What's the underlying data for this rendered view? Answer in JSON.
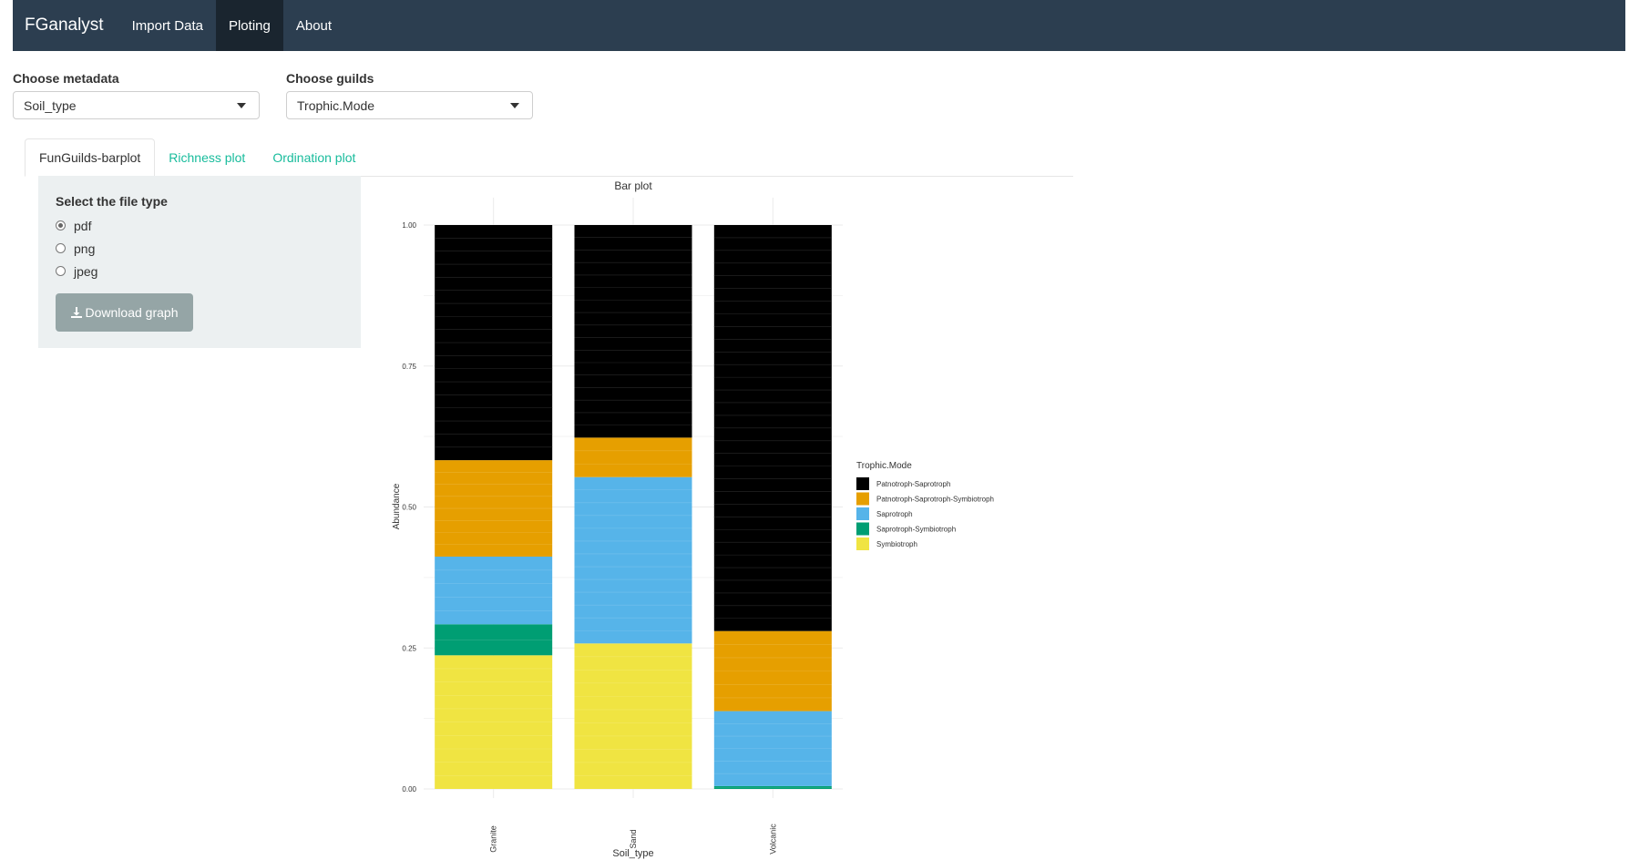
{
  "navbar": {
    "brand": "FGanalyst",
    "items": [
      "Import Data",
      "Ploting",
      "About"
    ],
    "active": "Ploting"
  },
  "controls": {
    "metadata": {
      "label": "Choose metadata",
      "value": "Soil_type"
    },
    "guilds": {
      "label": "Choose guilds",
      "value": "Trophic.Mode"
    }
  },
  "tabs": [
    "FunGuilds-barplot",
    "Richness plot",
    "Ordination plot"
  ],
  "panel": {
    "title": "Select the file type",
    "options": [
      "pdf",
      "png",
      "jpeg"
    ],
    "selected": "pdf",
    "download_label": "Download graph"
  },
  "colors": {
    "navbar_bg": "#2c3e50",
    "navbar_active": "#1a252f",
    "tab_link": "#18bc9c",
    "panel_bg": "#ecf0f1",
    "button_bg": "#95a5a6"
  },
  "chart_data": {
    "type": "bar",
    "stacked": true,
    "title": "Bar plot",
    "xlabel": "Soil_type",
    "ylabel": "Abundance",
    "ylim": [
      0,
      1
    ],
    "yticks": [
      "0.00",
      "0.25",
      "0.50",
      "0.75",
      "1.00"
    ],
    "categories": [
      "Granite",
      "Sand",
      "Volcanic"
    ],
    "legend_title": "Trophic.Mode",
    "legend_position": "right",
    "series": [
      {
        "name": "Symbiotroph",
        "color": "#f0e442",
        "values": [
          0.237,
          0.258,
          0.0
        ]
      },
      {
        "name": "Saprotroph-Symbiotroph",
        "color": "#009e73",
        "values": [
          0.055,
          0.0,
          0.005
        ]
      },
      {
        "name": "Saprotroph",
        "color": "#56b4e9",
        "values": [
          0.12,
          0.295,
          0.133
        ]
      },
      {
        "name": "Patnotroph-Saprotroph-Symbiotroph",
        "color": "#e69f00",
        "values": [
          0.171,
          0.07,
          0.142
        ]
      },
      {
        "name": "Patnotroph-Saprotroph",
        "color": "#000000",
        "values": [
          0.417,
          0.377,
          0.72
        ]
      }
    ],
    "legend_order": [
      "Patnotroph-Saprotroph",
      "Patnotroph-Saprotroph-Symbiotroph",
      "Saprotroph",
      "Saprotroph-Symbiotroph",
      "Symbiotroph"
    ],
    "grid": true
  }
}
